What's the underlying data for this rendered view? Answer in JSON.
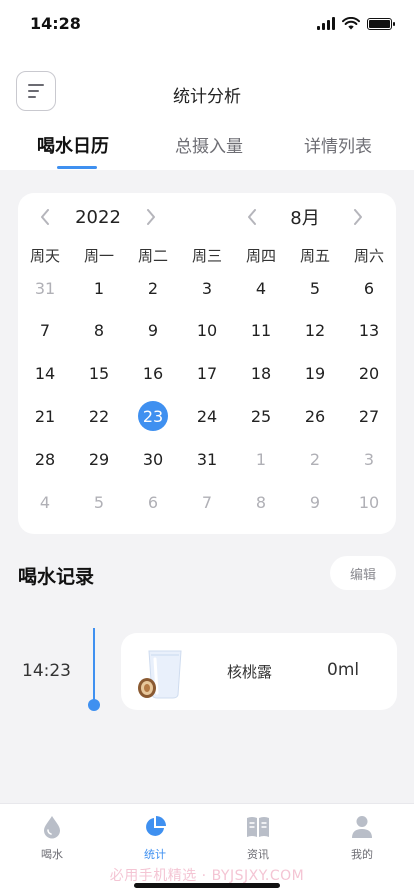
{
  "status": {
    "time": "14:28"
  },
  "header": {
    "title": "统计分析"
  },
  "tabs": [
    {
      "label": "喝水日历",
      "active": true
    },
    {
      "label": "总摄入量",
      "active": false
    },
    {
      "label": "详情列表",
      "active": false
    }
  ],
  "calendar": {
    "year": "2022",
    "month": "8月",
    "weekdays": [
      "周天",
      "周一",
      "周二",
      "周三",
      "周四",
      "周五",
      "周六"
    ],
    "weeks": [
      [
        {
          "d": "31",
          "m": true
        },
        {
          "d": "1"
        },
        {
          "d": "2"
        },
        {
          "d": "3"
        },
        {
          "d": "4"
        },
        {
          "d": "5"
        },
        {
          "d": "6"
        }
      ],
      [
        {
          "d": "7"
        },
        {
          "d": "8"
        },
        {
          "d": "9"
        },
        {
          "d": "10"
        },
        {
          "d": "11"
        },
        {
          "d": "12"
        },
        {
          "d": "13"
        }
      ],
      [
        {
          "d": "14"
        },
        {
          "d": "15"
        },
        {
          "d": "16"
        },
        {
          "d": "17"
        },
        {
          "d": "18"
        },
        {
          "d": "19"
        },
        {
          "d": "20"
        }
      ],
      [
        {
          "d": "21"
        },
        {
          "d": "22"
        },
        {
          "d": "23",
          "s": true
        },
        {
          "d": "24"
        },
        {
          "d": "25"
        },
        {
          "d": "26"
        },
        {
          "d": "27"
        }
      ],
      [
        {
          "d": "28"
        },
        {
          "d": "29"
        },
        {
          "d": "30"
        },
        {
          "d": "31"
        },
        {
          "d": "1",
          "m": true
        },
        {
          "d": "2",
          "m": true
        },
        {
          "d": "3",
          "m": true
        }
      ],
      [
        {
          "d": "4",
          "m": true
        },
        {
          "d": "5",
          "m": true
        },
        {
          "d": "6",
          "m": true
        },
        {
          "d": "7",
          "m": true
        },
        {
          "d": "8",
          "m": true
        },
        {
          "d": "9",
          "m": true
        },
        {
          "d": "10",
          "m": true
        }
      ]
    ],
    "selected_date": "23"
  },
  "records": {
    "title": "喝水记录",
    "edit_label": "编辑",
    "items": [
      {
        "time": "14:23",
        "name": "核桃露",
        "amount": "0ml"
      }
    ]
  },
  "bottom_nav": [
    {
      "label": "喝水",
      "icon": "water-drop-icon",
      "active": false
    },
    {
      "label": "统计",
      "icon": "pie-chart-icon",
      "active": true
    },
    {
      "label": "资讯",
      "icon": "book-icon",
      "active": false
    },
    {
      "label": "我的",
      "icon": "user-icon",
      "active": false
    }
  ],
  "watermark": "必用手机精选 · BYJSJXY.COM",
  "colors": {
    "accent": "#3f90f0",
    "background": "#f3f3f5",
    "muted_text": "#b0b0b6"
  }
}
